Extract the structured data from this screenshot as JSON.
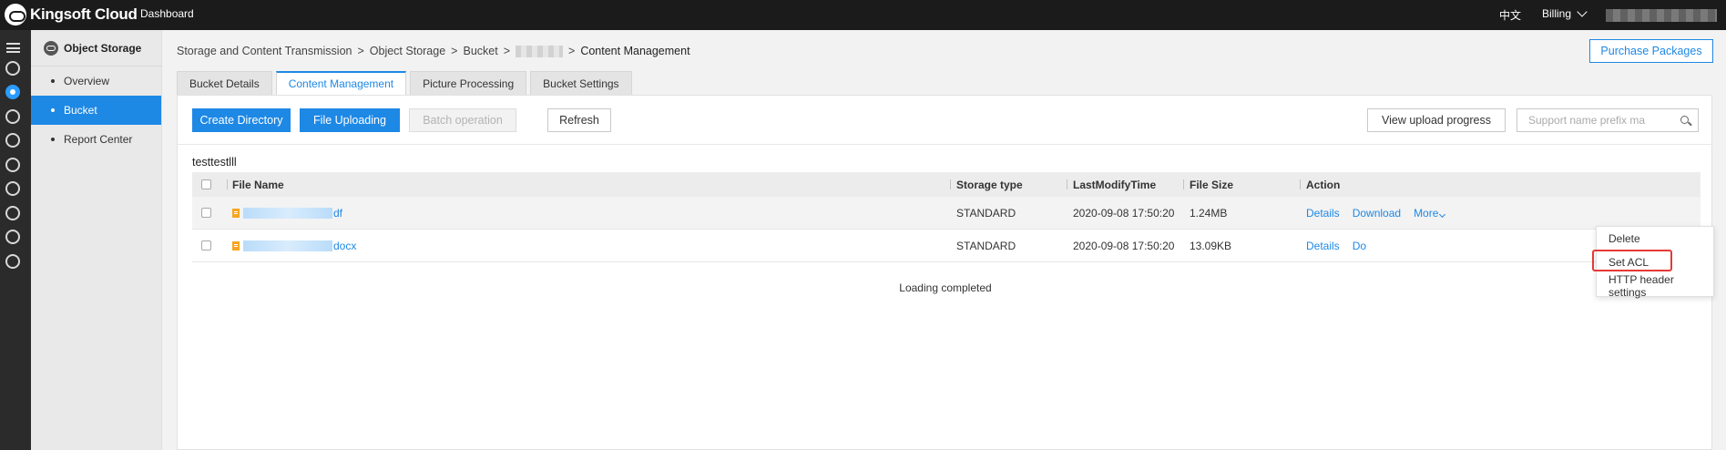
{
  "topbar": {
    "brand": "Kingsoft Cloud",
    "dashboard": "Dashboard",
    "language": "中文",
    "billing": "Billing"
  },
  "rail": {
    "icons": [
      "menu-icon",
      "storage-icon",
      "cloud-icon",
      "database-icon",
      "list-icon",
      "group-icon",
      "network-icon",
      "sync-icon",
      "server-icon",
      "monitor-icon"
    ]
  },
  "sidebar": {
    "title": "Object Storage",
    "items": [
      {
        "label": "Overview"
      },
      {
        "label": "Bucket"
      },
      {
        "label": "Report Center"
      }
    ]
  },
  "breadcrumb": {
    "parts": [
      "Storage and Content Transmission",
      "Object Storage",
      "Bucket",
      "Content Management"
    ],
    "separator": ">"
  },
  "header": {
    "purchase_label": "Purchase Packages"
  },
  "tabs": [
    {
      "label": "Bucket Details"
    },
    {
      "label": "Content Management"
    },
    {
      "label": "Picture Processing"
    },
    {
      "label": "Bucket Settings"
    }
  ],
  "toolbar": {
    "create_directory": "Create Directory",
    "file_uploading": "File Uploading",
    "batch_operation": "Batch operation",
    "refresh": "Refresh",
    "view_upload_progress": "View upload progress",
    "search_placeholder": "Support name prefix ma"
  },
  "path_label": "testtestlll",
  "table": {
    "columns": [
      "File Name",
      "Storage type",
      "LastModifyTime",
      "File Size",
      "Action"
    ],
    "rows": [
      {
        "name_suffix": "df",
        "storage_type": "STANDARD",
        "modified": "2020-09-08 17:50:20",
        "size": "1.24MB",
        "actions": [
          "Details",
          "Download",
          "More"
        ]
      },
      {
        "name_suffix": "docx",
        "storage_type": "STANDARD",
        "modified": "2020-09-08 17:50:20",
        "size": "13.09KB",
        "actions": [
          "Details",
          "Do"
        ]
      }
    ],
    "status": "Loading completed"
  },
  "dropdown": {
    "items": [
      "Delete",
      "Set ACL",
      "HTTP header settings"
    ],
    "highlighted": "Set ACL",
    "highlight_color": "#e53935"
  },
  "colors": {
    "accent": "#1e88e5",
    "topbar": "#1b1b1b",
    "rail": "#2b2b2b"
  }
}
